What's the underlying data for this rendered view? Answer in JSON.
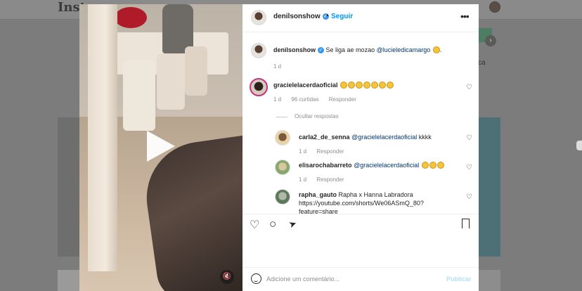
{
  "background": {
    "logo": "Insta",
    "side_text": "ca"
  },
  "post": {
    "username": "denilsonshow",
    "separator": "•",
    "follow_label": "Seguir",
    "more_label": "•••"
  },
  "caption": {
    "username": "denilsonshow",
    "text": "Se liga ae mozao",
    "mention": "@lucieledicamargo",
    "suffix": ".",
    "time": "1 d"
  },
  "comments": [
    {
      "username": "gracielelacerdaoficial",
      "text": "",
      "emoji_count": 7,
      "time": "1 d",
      "likes": "96 curtidas",
      "reply_label": "Responder"
    }
  ],
  "hide_replies_label": "Ocultar respostas",
  "replies": [
    {
      "username": "carla2_de_senna",
      "mention": "@gracielelacerdaoficial",
      "text": "kkkk",
      "time": "1 d",
      "reply_label": "Responder"
    },
    {
      "username": "elisarochabarreto",
      "mention": "@gracielelacerdaoficial",
      "text": "",
      "emoji_count": 3,
      "time": "1 d",
      "reply_label": "Responder"
    },
    {
      "username": "rapha_gauto",
      "text": "Rapha x Hanna Labradora",
      "line2": "https://youtube.com/shorts/We06ASmQ_80?",
      "line3": "feature=share"
    }
  ],
  "composer": {
    "placeholder": "Adicione um comentário...",
    "publish_label": "Publicar"
  },
  "icons": {
    "heart": "♡",
    "comment": "○",
    "share": "➤",
    "bookmark": "🔖",
    "mute": "🔇",
    "play": "▶"
  },
  "colors": {
    "link": "#0095f6",
    "verified": "#3897f0",
    "publish_disabled": "#b2dffc",
    "overlay": "#7c7c7c"
  }
}
